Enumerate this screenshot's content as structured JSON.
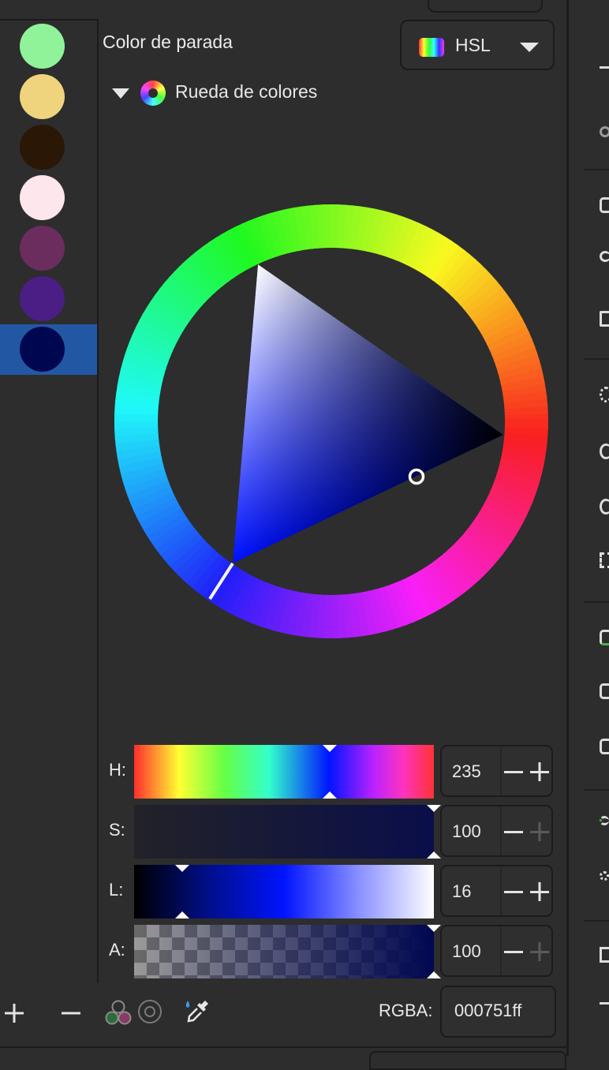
{
  "header": {
    "title": "Color de parada",
    "mode_select": {
      "value": "HSL",
      "icon": "rainbow-swatch-icon"
    }
  },
  "section": {
    "label": "Rueda de colores",
    "icon": "color-wheel-icon"
  },
  "swatches": [
    {
      "color": "#90f39a",
      "selected": false
    },
    {
      "color": "#efd47d",
      "selected": false
    },
    {
      "color": "#2a1705",
      "selected": false
    },
    {
      "color": "#fde6ec",
      "selected": false
    },
    {
      "color": "#6a2d5d",
      "selected": false
    },
    {
      "color": "#4b1e86",
      "selected": false
    },
    {
      "color": "#000751",
      "selected": true
    }
  ],
  "sliders": [
    {
      "key": "H",
      "label": "H:",
      "value": "235",
      "fraction": 0.653
    },
    {
      "key": "S",
      "label": "S:",
      "value": "100",
      "fraction": 1.0
    },
    {
      "key": "L",
      "label": "L:",
      "value": "16",
      "fraction": 0.16
    },
    {
      "key": "A",
      "label": "A:",
      "value": "100",
      "fraction": 1.0
    }
  ],
  "rgba": {
    "label": "RGBA:",
    "value": "000751ff"
  },
  "current_color": "#000751",
  "accent": "#2257a3",
  "bottom_tools": {
    "add": "plus-icon",
    "remove": "minus-icon",
    "mix": "color-mix-icon",
    "target": "target-icon",
    "picker": "eyedropper-icon"
  }
}
